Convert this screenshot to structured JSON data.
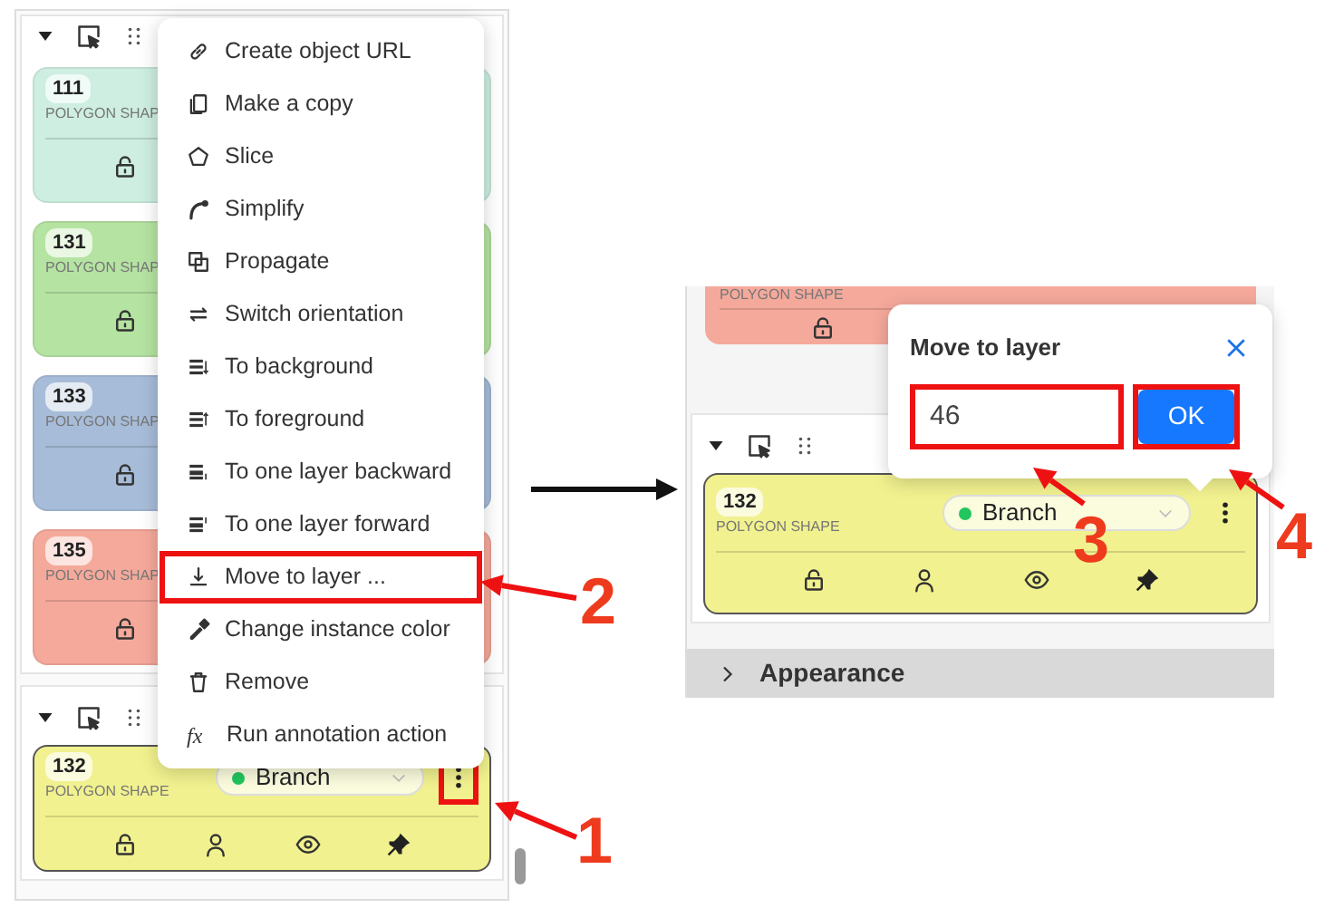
{
  "left_panel": {
    "cards": [
      {
        "number": "111",
        "type": "POLYGON SHAP",
        "color": "#cdeee0"
      },
      {
        "number": "131",
        "type": "POLYGON SHAP",
        "color": "#b5e3a2"
      },
      {
        "number": "133",
        "type": "POLYGON SHAP",
        "color": "#a7bcd8"
      },
      {
        "number": "135",
        "type": "POLYGON SHAP",
        "color": "#f5a99b"
      }
    ],
    "context_menu": {
      "items": [
        {
          "label": "Create object URL",
          "highlighted": false
        },
        {
          "label": "Make a copy",
          "highlighted": false
        },
        {
          "label": "Slice",
          "highlighted": false
        },
        {
          "label": "Simplify",
          "highlighted": false
        },
        {
          "label": "Propagate",
          "highlighted": false
        },
        {
          "label": "Switch orientation",
          "highlighted": false
        },
        {
          "label": "To background",
          "highlighted": false
        },
        {
          "label": "To foreground",
          "highlighted": false
        },
        {
          "label": "To one layer backward",
          "highlighted": false
        },
        {
          "label": "To one layer forward",
          "highlighted": false
        },
        {
          "label": "Move to layer ...",
          "highlighted": true
        },
        {
          "label": "Change instance color",
          "highlighted": false
        },
        {
          "label": "Remove",
          "highlighted": false
        },
        {
          "label": "Run annotation action",
          "glyph": "fx",
          "highlighted": false
        }
      ]
    },
    "active_card": {
      "number": "132",
      "type": "POLYGON SHAPE",
      "color": "#f1f18f",
      "label": {
        "text": "Branch",
        "color": "#22c55e"
      },
      "menu_highlighted": true
    }
  },
  "right_panel": {
    "partial_card": {
      "type": "POLYGON SHAPE",
      "color": "#f5a99b"
    },
    "card": {
      "number": "132",
      "type": "POLYGON SHAPE",
      "color": "#f1f18f",
      "label": {
        "text": "Branch",
        "color": "#22c55e"
      }
    },
    "dialog": {
      "title": "Move to layer",
      "value": "46",
      "button": "OK",
      "value_highlighted": true,
      "button_highlighted": true
    },
    "section": "Appearance"
  },
  "callouts": [
    {
      "number": "1"
    },
    {
      "number": "2"
    },
    {
      "number": "3"
    },
    {
      "number": "4"
    }
  ]
}
